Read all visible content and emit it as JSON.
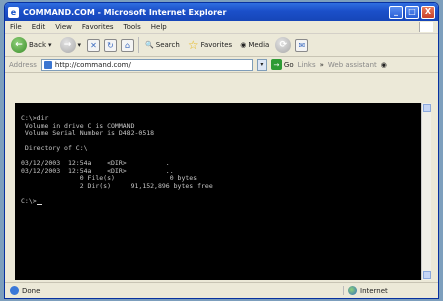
{
  "window": {
    "title": "COMMAND.COM - Microsoft Internet Explorer",
    "min": "_",
    "max": "□",
    "close": "X"
  },
  "menu": [
    "File",
    "Edit",
    "View",
    "Favorites",
    "Tools",
    "Help"
  ],
  "toolbar": {
    "back": "Back",
    "search": "Search",
    "favorites": "Favorites",
    "media": "Media"
  },
  "address": {
    "label": "Address",
    "url": "http://command.com/",
    "go": "Go",
    "links": "Links",
    "extra": "Web assistant"
  },
  "console": {
    "lines": [
      "C:\\>dir",
      " Volume in drive C is COMMAND",
      " Volume Serial Number is D482-0518",
      "",
      " Directory of C:\\",
      "",
      "03/12/2003  12:54a    <DIR>          .",
      "03/12/2003  12:54a    <DIR>          ..",
      "               0 File(s)              0 bytes",
      "               2 Dir(s)     91,152,896 bytes free",
      "",
      "C:\\>"
    ]
  },
  "status": {
    "left": "Done",
    "zone": "Internet"
  }
}
